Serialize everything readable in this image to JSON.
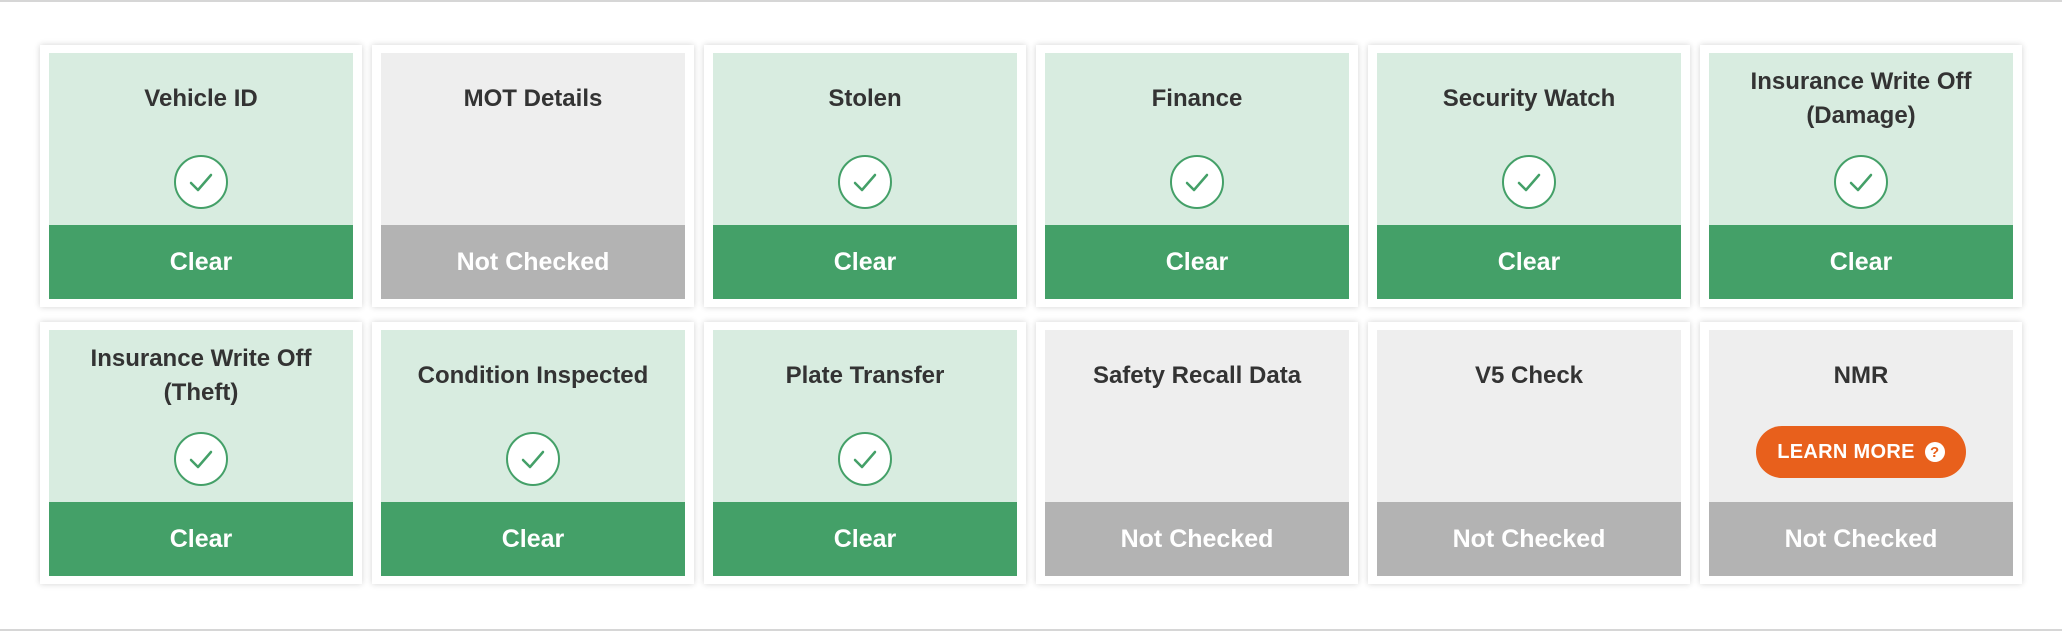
{
  "colors": {
    "clear_bar": "#44a068",
    "clear_body": "#d8ece0",
    "unchecked_bar": "#b3b3b3",
    "unchecked_body": "#eeeeee",
    "accent_orange": "#e8601c"
  },
  "cards": [
    {
      "title": "Vehicle ID",
      "status": "Clear",
      "icon": "check-circle-icon"
    },
    {
      "title": "MOT Details",
      "status": "Not Checked",
      "icon": ""
    },
    {
      "title": "Stolen",
      "status": "Clear",
      "icon": "check-circle-icon"
    },
    {
      "title": "Finance",
      "status": "Clear",
      "icon": "check-circle-icon"
    },
    {
      "title": "Security Watch",
      "status": "Clear",
      "icon": "check-circle-icon"
    },
    {
      "title": "Insurance Write Off (Damage)",
      "status": "Clear",
      "icon": "check-circle-icon"
    },
    {
      "title": "Insurance Write Off (Theft)",
      "status": "Clear",
      "icon": "check-circle-icon"
    },
    {
      "title": "Condition Inspected",
      "status": "Clear",
      "icon": "check-circle-icon"
    },
    {
      "title": "Plate Transfer",
      "status": "Clear",
      "icon": "check-circle-icon"
    },
    {
      "title": "Safety Recall Data",
      "status": "Not Checked",
      "icon": ""
    },
    {
      "title": "V5 Check",
      "status": "Not Checked",
      "icon": ""
    },
    {
      "title": "NMR",
      "status": "Not Checked",
      "icon": "",
      "button": {
        "label": "LEARN MORE",
        "icon": "question-circle-icon"
      }
    }
  ]
}
